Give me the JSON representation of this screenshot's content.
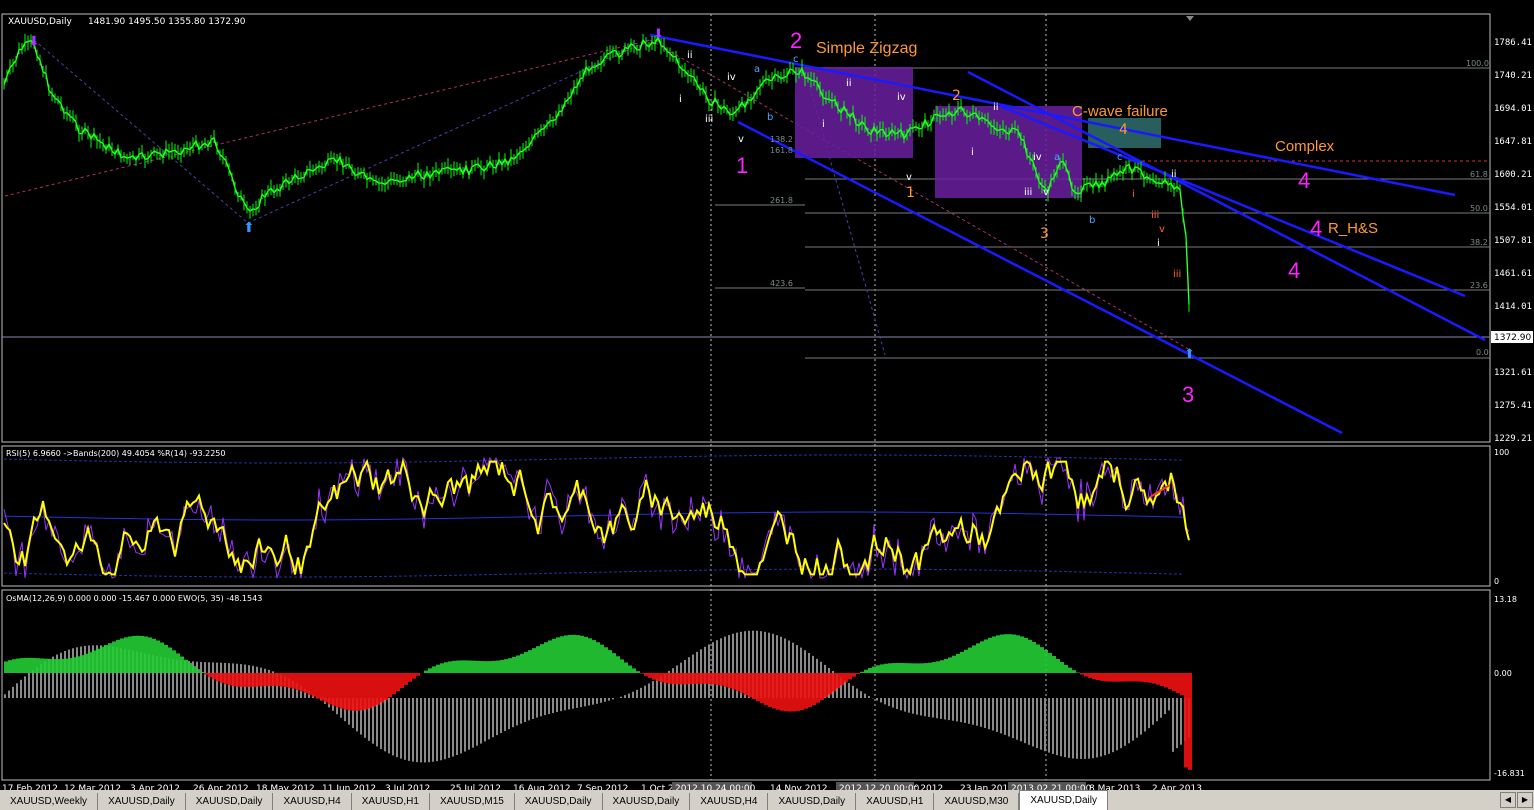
{
  "window": {
    "title": "XAUUSD,Daily",
    "ohlc": "1481.90 1495.50 1355.80 1372.90"
  },
  "colors": {
    "bg": "#000000",
    "candle": "#00ff00",
    "trend": "#1a1aff",
    "magenta": "#ff22ff",
    "orange": "#ff9933",
    "rsi": "#ffff00",
    "wpr": "#9933ff",
    "grid": "#c0c0c0"
  },
  "price_axis": {
    "labels": [
      "1786.41",
      "1740.21",
      "1694.01",
      "1647.81",
      "1600.21",
      "1554.01",
      "1507.81",
      "1461.61",
      "1414.01",
      "1321.61",
      "1275.41",
      "1229.21"
    ],
    "current": "1372.90"
  },
  "rsi_panel": {
    "label": "RSI(5) 6.9660  ->Bands(200) 49.4054  %R(14) -93.2250",
    "axis": [
      "100",
      "0"
    ]
  },
  "osma_panel": {
    "label": "OsMA(12,26,9) 0.000 0.000 -15.467 0.000  EWO(5, 35) -48.1543",
    "axis": [
      "13.18",
      "0.00",
      "-16.831"
    ]
  },
  "time_axis": {
    "labels": [
      "17 Feb 2012",
      "12 Mar 2012",
      "3 Apr 2012",
      "26 Apr 2012",
      "18 May 2012",
      "11 Jun 2012",
      "3 Jul 2012",
      "25 Jul 2012",
      "16 Aug 2012",
      "7 Sep 2012",
      "1 Oct 2",
      "14 Nov 2012",
      "Dec 2012",
      "23 Jan 201",
      "8 Mar 2013",
      "2 Apr 2013"
    ],
    "boxes": [
      "2012.10.24 00:00",
      "2012.12.20 00:00",
      "2013.02.21 00:00"
    ]
  },
  "fib_levels": [
    "100.0",
    "61.8",
    "50.0",
    "38.2",
    "23.6",
    "0.0"
  ],
  "fib_ext": [
    "261.8",
    "423.6",
    "138.2",
    "161.8"
  ],
  "annotations": {
    "simple_zigzag": "Simple Zigzag",
    "cwave": "C-wave failure",
    "complex": "Complex",
    "rhs": "R_H&S",
    "w1": "1",
    "w2": "2",
    "w3": "3",
    "w4a": "4",
    "w4b": "4",
    "w4c": "4",
    "sub": [
      "ii",
      "iv",
      "a",
      "c",
      "b",
      "i",
      "iii",
      "v",
      "ii",
      "i",
      "iv",
      "ii",
      "v",
      "i",
      "iii",
      "iv",
      "a",
      "b",
      "c",
      "ii",
      "i",
      "iii",
      "v",
      "i",
      "iii",
      "v",
      "1",
      "2",
      "3",
      "4"
    ]
  },
  "tabs": [
    "XAUUSD,Weekly",
    "XAUUSD,Daily",
    "XAUUSD,Daily",
    "XAUUSD,H4",
    "XAUUSD,H1",
    "XAUUSD,M15",
    "XAUUSD,Daily",
    "XAUUSD,Daily",
    "XAUUSD,H4",
    "XAUUSD,Daily",
    "XAUUSD,H1",
    "XAUUSD,M30",
    "XAUUSD,Daily"
  ],
  "chart_data": {
    "type": "candlestick",
    "symbol": "XAUUSD",
    "timeframe": "Daily",
    "ylim": [
      1229.21,
      1786.41
    ],
    "x": [
      "17 Feb 2012",
      "12 Mar 2012",
      "3 Apr 2012",
      "26 Apr 2012",
      "18 May 2012",
      "11 Jun 2012",
      "3 Jul 2012",
      "25 Jul 2012",
      "16 Aug 2012",
      "7 Sep 2012",
      "1 Oct 2012",
      "14 Nov 2012",
      "Dec 2012",
      "23 Jan 2013",
      "8 Mar 2013",
      "2 Apr 2013"
    ],
    "close_approx": [
      1770,
      1660,
      1640,
      1640,
      1560,
      1610,
      1580,
      1600,
      1620,
      1720,
      1780,
      1720,
      1700,
      1670,
      1580,
      1372.9
    ]
  }
}
